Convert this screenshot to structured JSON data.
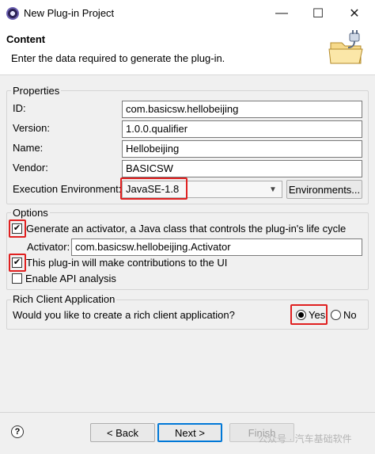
{
  "window": {
    "title": "New Plug-in Project",
    "minimize_glyph": "—",
    "maximize_glyph": "☐",
    "close_glyph": "✕"
  },
  "header": {
    "title": "Content",
    "description": "Enter the data required to generate the plug-in.",
    "banner_icon": "plugin-folder-icon"
  },
  "properties": {
    "legend": "Properties",
    "id": {
      "label": "ID:",
      "value": "com.basicsw.hellobeijing"
    },
    "version": {
      "label": "Version:",
      "value": "1.0.0.qualifier"
    },
    "name": {
      "label": "Name:",
      "value": "Hellobeijing"
    },
    "vendor": {
      "label": "Vendor:",
      "value": "BASICSW"
    },
    "exec_env": {
      "label": "Execution Environment:",
      "value": "JavaSE-1.8",
      "button": "Environments..."
    }
  },
  "options": {
    "legend": "Options",
    "generate_activator": {
      "label": "Generate an activator, a Java class that controls the plug-in's life cycle",
      "checked": true
    },
    "activator": {
      "label": "Activator:",
      "value": "com.basicsw.hellobeijing.Activator"
    },
    "ui_contrib": {
      "label": "This plug-in will make contributions to the UI",
      "checked": true
    },
    "api_analysis": {
      "label": "Enable API analysis",
      "checked": false
    }
  },
  "rca": {
    "legend": "Rich Client Application",
    "question": "Would you like to create a rich client application?",
    "yes_label": "Yes",
    "no_label": "No",
    "selected": "Yes"
  },
  "footer": {
    "help_glyph": "?",
    "back_label": "< Back",
    "next_label": "Next >",
    "finish_label": "Finish"
  },
  "watermark": "公众号 · 汽车基础软件",
  "colors": {
    "highlight": "#e02020",
    "focus": "#0078d7"
  }
}
